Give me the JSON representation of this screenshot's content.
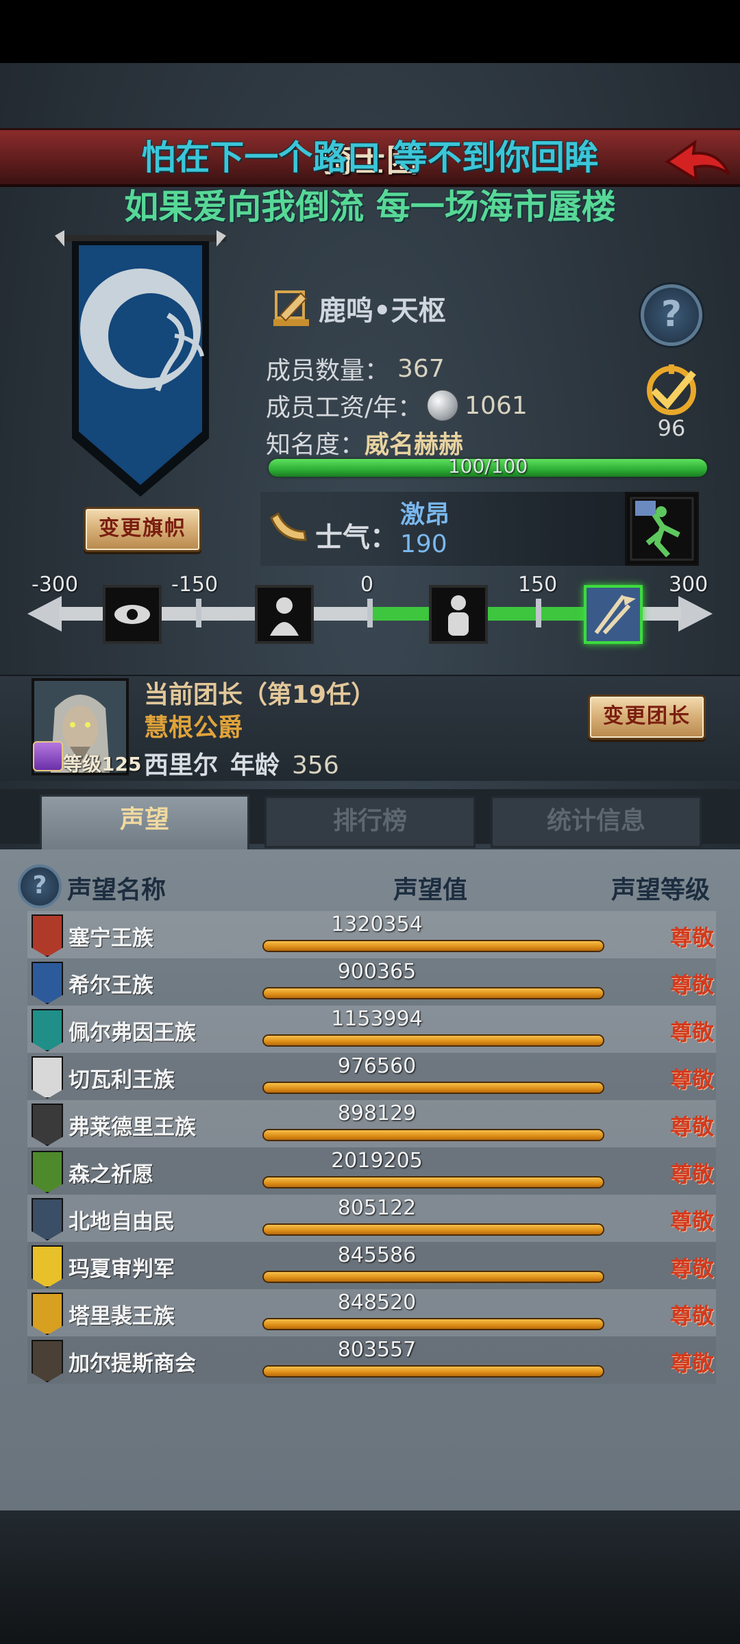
{
  "header": {
    "title": "骑士团"
  },
  "lyrics": {
    "line1": "怕在下一个路口 等不到你回眸",
    "line2": "如果爱向我倒流 每一场海市蜃楼"
  },
  "guild": {
    "name": "鹿鸣•天枢",
    "member_count_label": "成员数量：",
    "member_count": "367",
    "salary_label": "成员工资/年：",
    "salary": "1061",
    "fame_label": "知名度：",
    "fame_value": "威名赫赫",
    "fame_progress_text": "100/100",
    "fame_progress": 1.0,
    "emblem_value": "96",
    "change_flag_label": "变更旗帜"
  },
  "morale": {
    "label": "士气：",
    "state": "激昂",
    "value": "190",
    "scale_ticks": [
      "-300",
      "-150",
      "0",
      "150",
      "300"
    ]
  },
  "leader": {
    "title": "当前团长（第19任）",
    "rank": "慧根公爵",
    "level_label": "等级125",
    "name": "西里尔",
    "age_label": "年龄",
    "age": "356",
    "change_leader_label": "变更团长"
  },
  "tabs": [
    {
      "label": "声望"
    },
    {
      "label": "排行榜"
    },
    {
      "label": "统计信息"
    }
  ],
  "table": {
    "headers": {
      "name": "声望名称",
      "value": "声望值",
      "level": "声望等级"
    },
    "rows": [
      {
        "name": "塞宁王族",
        "value": "1320354",
        "level": "尊敬",
        "color": "#b03a2a"
      },
      {
        "name": "希尔王族",
        "value": "900365",
        "level": "尊敬",
        "color": "#2d5a9a"
      },
      {
        "name": "佩尔弗因王族",
        "value": "1153994",
        "level": "尊敬",
        "color": "#1f8f88"
      },
      {
        "name": "切瓦利王族",
        "value": "976560",
        "level": "尊敬",
        "color": "#d8d8d8"
      },
      {
        "name": "弗莱德里王族",
        "value": "898129",
        "level": "尊敬",
        "color": "#3a3a3a"
      },
      {
        "name": "森之祈愿",
        "value": "2019205",
        "level": "尊敬",
        "color": "#4e8a2c"
      },
      {
        "name": "北地自由民",
        "value": "805122",
        "level": "尊敬",
        "color": "#3a4e66"
      },
      {
        "name": "玛夏审判军",
        "value": "845586",
        "level": "尊敬",
        "color": "#e8c02a"
      },
      {
        "name": "塔里裴王族",
        "value": "848520",
        "level": "尊敬",
        "color": "#d8a020"
      },
      {
        "name": "加尔提斯商会",
        "value": "803557",
        "level": "尊敬",
        "color": "#4a4036"
      }
    ]
  },
  "colors": {
    "accent_gold": "#e0a33a",
    "morale_blue": "#7ab8ee",
    "rep_level_red": "#d23a1e",
    "fame_green": "#2dae35"
  }
}
